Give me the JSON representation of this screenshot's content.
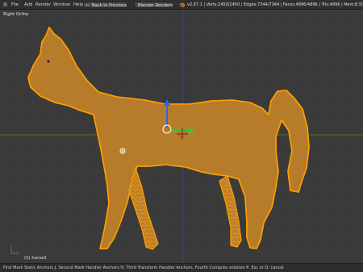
{
  "menu": {
    "file": "File",
    "add": "Add",
    "render": "Render",
    "window": "Window",
    "help": "Help",
    "back_button": "Back to Previous",
    "render_engine": "Blender Render",
    "blender_icon": "blender-icon",
    "stats": "v2.67.1 | Verts:2450/2450 | Edges:7344/7344 | Faces:4896/4896 | Tris:4896 | Mem:8.50M (0"
  },
  "viewport": {
    "view_name": "Right Ortho",
    "object_label": "(1) horse2"
  },
  "status": {
    "hint": "First Mark Static Anchors J, Second Mark Handler Anchors H, Third Transform Handler Anchors, Fourth Compute solution P, Esc or Q: cancel"
  },
  "colors": {
    "mesh_wire": "#ff9f00",
    "mesh_fill": "#b77c2a",
    "background": "#393939",
    "axis_green": "#5f8a2c",
    "axis_blue": "#3b4d9a",
    "gizmo_blue": "#3b5fe6",
    "gizmo_green": "#3cc43c",
    "gizmo_red": "#e03a2a"
  }
}
